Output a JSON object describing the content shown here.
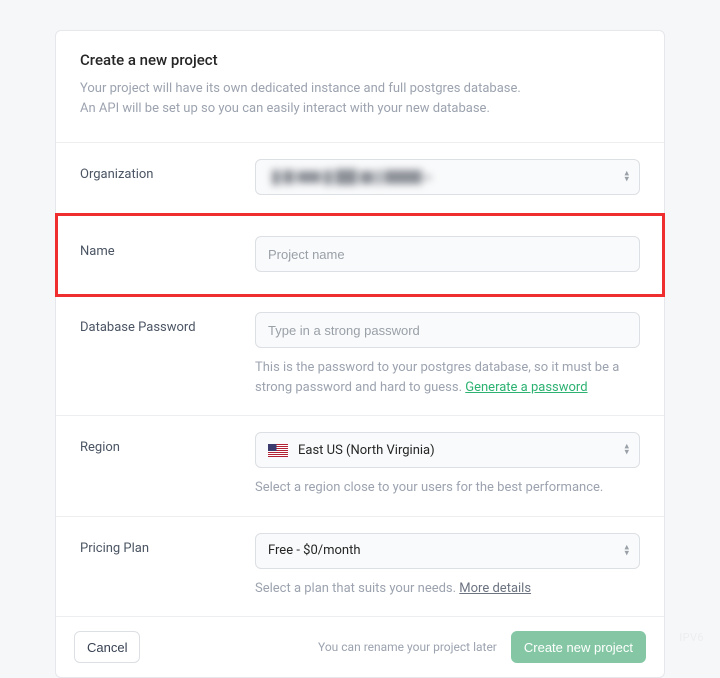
{
  "header": {
    "title": "Create a new project",
    "desc_line1": "Your project will have its own dedicated instance and full postgres database.",
    "desc_line2": "An API will be set up so you can easily interact with your new database."
  },
  "org": {
    "label": "Organization",
    "value_hidden": true
  },
  "name": {
    "label": "Name",
    "placeholder": "Project name"
  },
  "password": {
    "label": "Database Password",
    "placeholder": "Type in a strong password",
    "helper_prefix": "This is the password to your postgres database, so it must be a strong password and hard to guess. ",
    "generate_link": "Generate a password"
  },
  "region": {
    "label": "Region",
    "selected": "East US (North Virginia)",
    "helper": "Select a region close to your users for the best performance."
  },
  "plan": {
    "label": "Pricing Plan",
    "selected": "Free - $0/month",
    "helper_prefix": "Select a plan that suits your needs. ",
    "more_link": "More details"
  },
  "footer": {
    "cancel": "Cancel",
    "rename_hint": "You can rename your project later",
    "submit": "Create new project"
  }
}
